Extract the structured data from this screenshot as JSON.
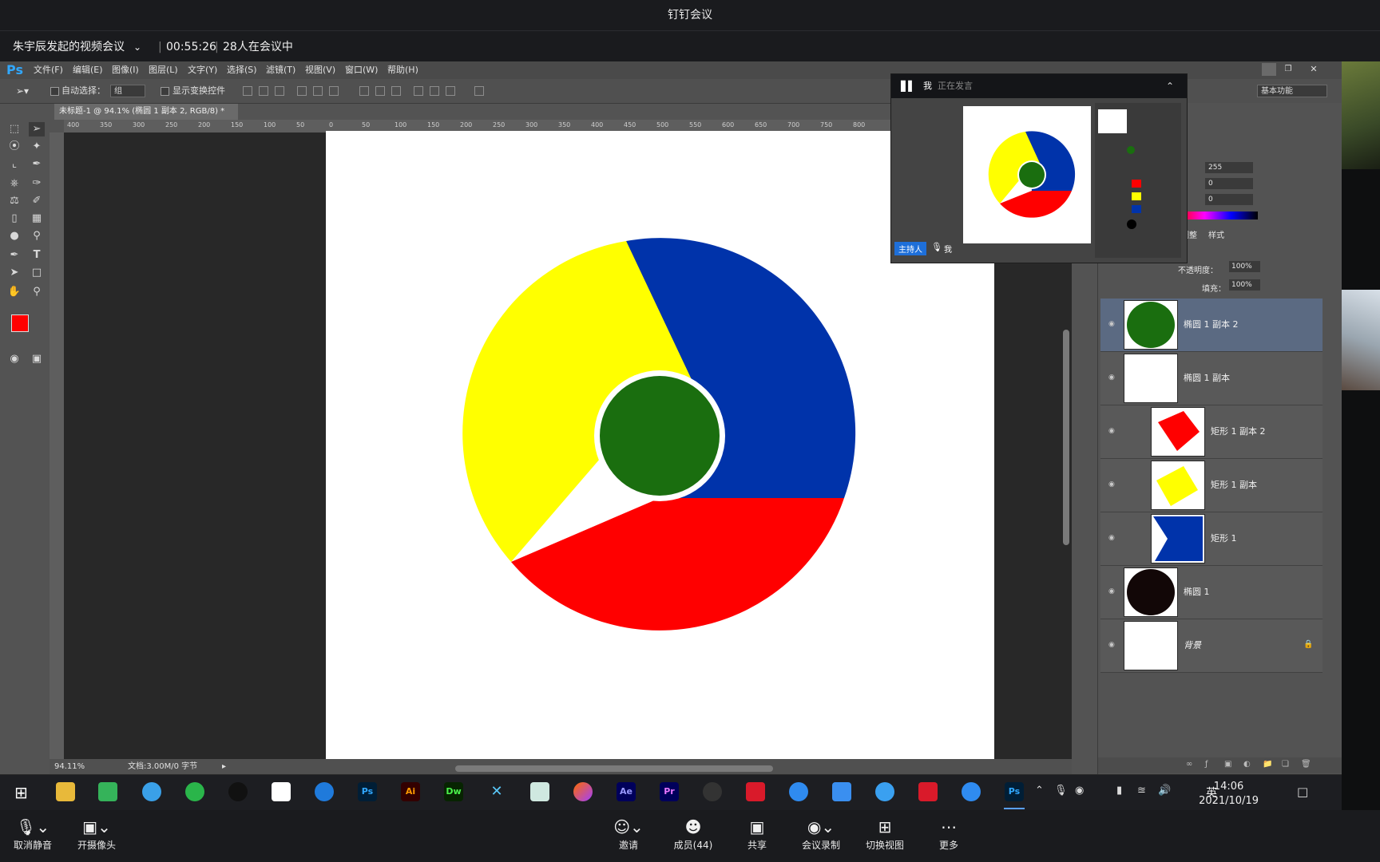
{
  "meeting": {
    "window_title": "钉钉会议",
    "meeting_name": "朱宇辰发起的视频会议",
    "duration": "00:55:26",
    "participants_status": "28人在会议中"
  },
  "photoshop": {
    "logo": "Ps",
    "menus": [
      "文件(F)",
      "编辑(E)",
      "图像(I)",
      "图层(L)",
      "文字(Y)",
      "选择(S)",
      "滤镜(T)",
      "视图(V)",
      "窗口(W)",
      "帮助(H)"
    ],
    "options": {
      "auto_select_label": "自动选择：",
      "auto_select_value": "组",
      "show_transform_label": "显示变换控件",
      "workspace": "基本功能"
    },
    "document_tab": "未标题-1 @ 94.1% (椭圆 1 副本 2, RGB/8) *",
    "zoom": "94.11%",
    "doc_size": "文档:3.00M/0 字节",
    "ruler_h": [
      "400",
      "350",
      "300",
      "250",
      "200",
      "150",
      "100",
      "50",
      "0",
      "50",
      "100",
      "150",
      "200",
      "250",
      "300",
      "350",
      "400",
      "450",
      "500",
      "550",
      "600",
      "650",
      "700",
      "750",
      "800"
    ],
    "color_panel": {
      "r": "255",
      "g": "0",
      "b": "0"
    },
    "panel_tabs": [
      "调整",
      "样式"
    ],
    "opacity_label": "不透明度：",
    "opacity_value": "100%",
    "fill_label": "填充：",
    "fill_value": "100%",
    "layers": [
      {
        "name": "椭圆 1 副本 2",
        "thumb": "green-circle",
        "selected": true
      },
      {
        "name": "椭圆 1 副本",
        "thumb": "white-circle",
        "selected": false
      },
      {
        "name": "矩形 1 副本 2",
        "thumb": "red-shape",
        "selected": false
      },
      {
        "name": "矩形 1 副本",
        "thumb": "yellow-shape",
        "selected": false
      },
      {
        "name": "矩形 1",
        "thumb": "blue-shape",
        "selected": false
      },
      {
        "name": "椭圆 1",
        "thumb": "black-circle",
        "selected": false
      },
      {
        "name": "背景",
        "thumb": "white",
        "selected": false
      }
    ],
    "colors": {
      "blue": "#0033aa",
      "yellow": "#ffff00",
      "red": "#ff0000",
      "green": "#1a6e0f",
      "fg": "#ff0000"
    }
  },
  "share_window": {
    "speaker_label": "我",
    "speaking_text": "正在发言",
    "host_badge": "主持人",
    "self_label": "我"
  },
  "taskbar": {
    "apps": [
      "Ps",
      "Ai",
      "Dw",
      "Ae",
      "Pr",
      "Ps"
    ],
    "ime": "英",
    "time": "14:06",
    "date": "2021/10/19"
  },
  "meeting_toolbar": {
    "unmute": "取消静音",
    "camera": "开摄像头",
    "invite": "邀请",
    "members": "成员(44)",
    "share": "共享",
    "record": "会议录制",
    "switch_view": "切换视图",
    "more": "更多"
  }
}
